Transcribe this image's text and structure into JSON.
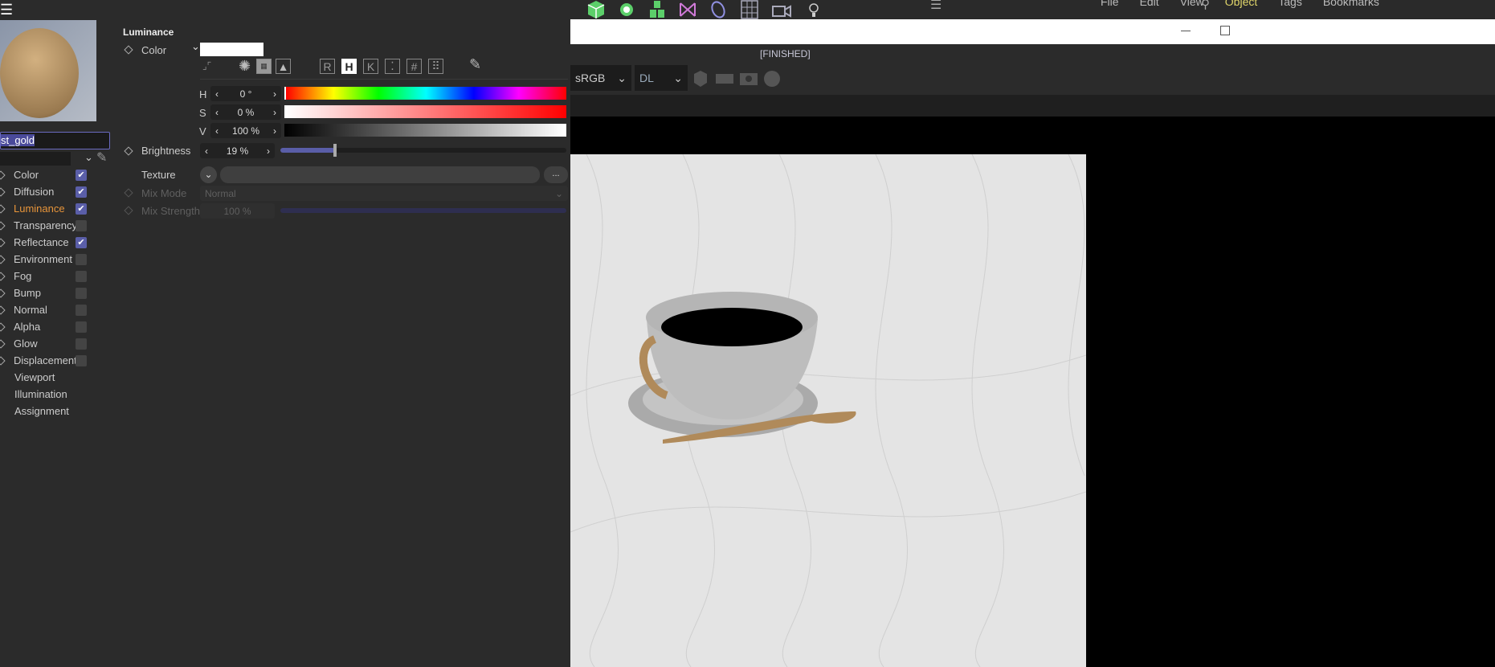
{
  "manager_menu": [
    "File",
    "Edit",
    "View",
    "Object",
    "Tags",
    "Bookmarks"
  ],
  "render_view": {
    "status": "[FINISHED]",
    "color_profile": "sRGB",
    "display": "DL"
  },
  "material": {
    "name": "st_gold"
  },
  "channels": [
    {
      "label": "Color",
      "checked": true
    },
    {
      "label": "Diffusion",
      "checked": true
    },
    {
      "label": "Luminance",
      "checked": true,
      "active": true
    },
    {
      "label": "Transparency",
      "checked": false
    },
    {
      "label": "Reflectance",
      "checked": true
    },
    {
      "label": "Environment",
      "checked": false
    },
    {
      "label": "Fog",
      "checked": false
    },
    {
      "label": "Bump",
      "checked": false
    },
    {
      "label": "Normal",
      "checked": false
    },
    {
      "label": "Alpha",
      "checked": false
    },
    {
      "label": "Glow",
      "checked": false
    },
    {
      "label": "Displacement",
      "checked": false
    },
    {
      "label": "Viewport"
    },
    {
      "label": "Illumination"
    },
    {
      "label": "Assignment"
    }
  ],
  "luminance": {
    "title": "Luminance",
    "color_label": "Color",
    "color_value": "#ffffff",
    "mode_buttons": [
      "R",
      "H",
      "K",
      "⁚",
      "#",
      "⠿"
    ],
    "active_mode": "H",
    "h_label": "H",
    "h_value": "0 °",
    "s_label": "S",
    "s_value": "0 %",
    "v_label": "V",
    "v_value": "100 %",
    "brightness_label": "Brightness",
    "brightness_value": "19 %",
    "brightness_fraction": 0.19,
    "texture_label": "Texture",
    "texture_more": "...",
    "mix_mode_label": "Mix Mode",
    "mix_mode_value": "Normal",
    "mix_strength_label": "Mix Strength",
    "mix_strength_value": "100 %"
  },
  "colors": {
    "accent": "#5a5ea8",
    "active_channel": "#e8953a",
    "panel": "#2b2b2b"
  }
}
